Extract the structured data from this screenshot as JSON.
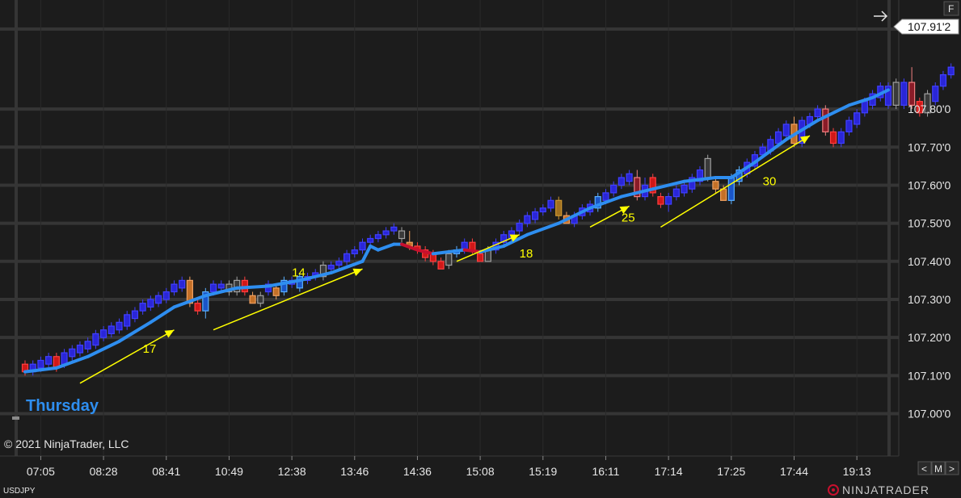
{
  "chart_data": {
    "type": "candlestick",
    "symbol": "USDJPY",
    "day_label": "Thursday",
    "copyright": "© 2021 NinjaTrader, LLC",
    "brand": "NINJATRADER",
    "last_price": "107.91'2",
    "panel_button": "F",
    "nav_buttons": [
      "<",
      "M",
      ">"
    ],
    "ylim": [
      106.91,
      108.01
    ],
    "y_ticks": [
      {
        "value": 107.8,
        "label": "107.80'0"
      },
      {
        "value": 107.7,
        "label": "107.70'0"
      },
      {
        "value": 107.6,
        "label": "107.60'0"
      },
      {
        "value": 107.5,
        "label": "107.50'0"
      },
      {
        "value": 107.4,
        "label": "107.40'0"
      },
      {
        "value": 107.3,
        "label": "107.30'0"
      },
      {
        "value": 107.2,
        "label": "107.20'0"
      },
      {
        "value": 107.1,
        "label": "107.10'0"
      },
      {
        "value": 107.0,
        "label": "107.00'0"
      }
    ],
    "x_ticks": [
      {
        "bar": 2,
        "label": "07:05"
      },
      {
        "bar": 10,
        "label": "08:28"
      },
      {
        "bar": 18,
        "label": "08:41"
      },
      {
        "bar": 26,
        "label": "10:49"
      },
      {
        "bar": 34,
        "label": "12:38"
      },
      {
        "bar": 42,
        "label": "13:46"
      },
      {
        "bar": 50,
        "label": "14:36"
      },
      {
        "bar": 58,
        "label": "15:08"
      },
      {
        "bar": 66,
        "label": "15:19"
      },
      {
        "bar": 74,
        "label": "16:11"
      },
      {
        "bar": 82,
        "label": "17:14"
      },
      {
        "bar": 90,
        "label": "17:25"
      },
      {
        "bar": 98,
        "label": "17:44"
      },
      {
        "bar": 106,
        "label": "19:13"
      }
    ],
    "bar_count": 111,
    "candles": [
      {
        "o": 107.11,
        "c": 107.13,
        "h": 107.14,
        "l": 107.1,
        "k": "r"
      },
      {
        "o": 107.11,
        "c": 107.13,
        "h": 107.14,
        "l": 107.1,
        "k": "b"
      },
      {
        "o": 107.12,
        "c": 107.14,
        "h": 107.15,
        "l": 107.11,
        "k": "b"
      },
      {
        "o": 107.13,
        "c": 107.15,
        "h": 107.16,
        "l": 107.12,
        "k": "b"
      },
      {
        "o": 107.15,
        "c": 107.12,
        "h": 107.16,
        "l": 107.11,
        "k": "r"
      },
      {
        "o": 107.13,
        "c": 107.16,
        "h": 107.17,
        "l": 107.12,
        "k": "b"
      },
      {
        "o": 107.15,
        "c": 107.17,
        "h": 107.18,
        "l": 107.14,
        "k": "b"
      },
      {
        "o": 107.16,
        "c": 107.18,
        "h": 107.19,
        "l": 107.15,
        "k": "b"
      },
      {
        "o": 107.17,
        "c": 107.19,
        "h": 107.2,
        "l": 107.16,
        "k": "b"
      },
      {
        "o": 107.18,
        "c": 107.21,
        "h": 107.22,
        "l": 107.17,
        "k": "b"
      },
      {
        "o": 107.2,
        "c": 107.22,
        "h": 107.23,
        "l": 107.19,
        "k": "b"
      },
      {
        "o": 107.21,
        "c": 107.23,
        "h": 107.24,
        "l": 107.2,
        "k": "b"
      },
      {
        "o": 107.22,
        "c": 107.24,
        "h": 107.25,
        "l": 107.21,
        "k": "b"
      },
      {
        "o": 107.23,
        "c": 107.26,
        "h": 107.27,
        "l": 107.22,
        "k": "b"
      },
      {
        "o": 107.25,
        "c": 107.27,
        "h": 107.28,
        "l": 107.24,
        "k": "b"
      },
      {
        "o": 107.27,
        "c": 107.29,
        "h": 107.3,
        "l": 107.26,
        "k": "b"
      },
      {
        "o": 107.28,
        "c": 107.3,
        "h": 107.31,
        "l": 107.27,
        "k": "b"
      },
      {
        "o": 107.29,
        "c": 107.31,
        "h": 107.32,
        "l": 107.28,
        "k": "b"
      },
      {
        "o": 107.3,
        "c": 107.32,
        "h": 107.33,
        "l": 107.29,
        "k": "b"
      },
      {
        "o": 107.32,
        "c": 107.34,
        "h": 107.35,
        "l": 107.31,
        "k": "b"
      },
      {
        "o": 107.33,
        "c": 107.35,
        "h": 107.36,
        "l": 107.32,
        "k": "b"
      },
      {
        "o": 107.35,
        "c": 107.29,
        "h": 107.36,
        "l": 107.28,
        "k": "o"
      },
      {
        "o": 107.29,
        "c": 107.27,
        "h": 107.3,
        "l": 107.26,
        "k": "r"
      },
      {
        "o": 107.27,
        "c": 107.32,
        "h": 107.33,
        "l": 107.25,
        "k": "l"
      },
      {
        "o": 107.32,
        "c": 107.34,
        "h": 107.35,
        "l": 107.31,
        "k": "b"
      },
      {
        "o": 107.33,
        "c": 107.34,
        "h": 107.35,
        "l": 107.32,
        "k": "b"
      },
      {
        "o": 107.34,
        "c": 107.32,
        "h": 107.35,
        "l": 107.31,
        "k": "g"
      },
      {
        "o": 107.32,
        "c": 107.35,
        "h": 107.36,
        "l": 107.31,
        "k": "g"
      },
      {
        "o": 107.35,
        "c": 107.32,
        "h": 107.36,
        "l": 107.31,
        "k": "r"
      },
      {
        "o": 107.31,
        "c": 107.29,
        "h": 107.32,
        "l": 107.29,
        "k": "o"
      },
      {
        "o": 107.29,
        "c": 107.31,
        "h": 107.32,
        "l": 107.28,
        "k": "g"
      },
      {
        "o": 107.32,
        "c": 107.34,
        "h": 107.35,
        "l": 107.31,
        "k": "b"
      },
      {
        "o": 107.33,
        "c": 107.31,
        "h": 107.34,
        "l": 107.3,
        "k": "o"
      },
      {
        "o": 107.32,
        "c": 107.35,
        "h": 107.36,
        "l": 107.31,
        "k": "l"
      },
      {
        "o": 107.34,
        "c": 107.35,
        "h": 107.36,
        "l": 107.33,
        "k": "b"
      },
      {
        "o": 107.33,
        "c": 107.36,
        "h": 107.37,
        "l": 107.32,
        "k": "l"
      },
      {
        "o": 107.35,
        "c": 107.36,
        "h": 107.37,
        "l": 107.34,
        "k": "b"
      },
      {
        "o": 107.36,
        "c": 107.37,
        "h": 107.38,
        "l": 107.35,
        "k": "b"
      },
      {
        "o": 107.36,
        "c": 107.39,
        "h": 107.4,
        "l": 107.35,
        "k": "g"
      },
      {
        "o": 107.38,
        "c": 107.39,
        "h": 107.4,
        "l": 107.37,
        "k": "b"
      },
      {
        "o": 107.39,
        "c": 107.4,
        "h": 107.41,
        "l": 107.38,
        "k": "b"
      },
      {
        "o": 107.4,
        "c": 107.42,
        "h": 107.43,
        "l": 107.39,
        "k": "b"
      },
      {
        "o": 107.42,
        "c": 107.43,
        "h": 107.44,
        "l": 107.41,
        "k": "b"
      },
      {
        "o": 107.43,
        "c": 107.45,
        "h": 107.46,
        "l": 107.42,
        "k": "b"
      },
      {
        "o": 107.45,
        "c": 107.46,
        "h": 107.47,
        "l": 107.44,
        "k": "b"
      },
      {
        "o": 107.46,
        "c": 107.47,
        "h": 107.48,
        "l": 107.45,
        "k": "b"
      },
      {
        "o": 107.47,
        "c": 107.48,
        "h": 107.49,
        "l": 107.46,
        "k": "b"
      },
      {
        "o": 107.48,
        "c": 107.49,
        "h": 107.5,
        "l": 107.47,
        "k": "b"
      },
      {
        "o": 107.48,
        "c": 107.46,
        "h": 107.49,
        "l": 107.45,
        "k": "g"
      },
      {
        "o": 107.45,
        "c": 107.44,
        "h": 107.48,
        "l": 107.43,
        "k": "o"
      },
      {
        "o": 107.44,
        "c": 107.43,
        "h": 107.45,
        "l": 107.42,
        "k": "r"
      },
      {
        "o": 107.43,
        "c": 107.41,
        "h": 107.44,
        "l": 107.4,
        "k": "r"
      },
      {
        "o": 107.42,
        "c": 107.4,
        "h": 107.43,
        "l": 107.39,
        "k": "r"
      },
      {
        "o": 107.4,
        "c": 107.38,
        "h": 107.41,
        "l": 107.38,
        "k": "r"
      },
      {
        "o": 107.39,
        "c": 107.42,
        "h": 107.43,
        "l": 107.38,
        "k": "g"
      },
      {
        "o": 107.42,
        "c": 107.43,
        "h": 107.44,
        "l": 107.41,
        "k": "l"
      },
      {
        "o": 107.43,
        "c": 107.45,
        "h": 107.46,
        "l": 107.42,
        "k": "b"
      },
      {
        "o": 107.45,
        "c": 107.43,
        "h": 107.46,
        "l": 107.42,
        "k": "r"
      },
      {
        "o": 107.42,
        "c": 107.4,
        "h": 107.43,
        "l": 107.4,
        "k": "r"
      },
      {
        "o": 107.4,
        "c": 107.43,
        "h": 107.44,
        "l": 107.4,
        "k": "g"
      },
      {
        "o": 107.43,
        "c": 107.45,
        "h": 107.46,
        "l": 107.42,
        "k": "b"
      },
      {
        "o": 107.45,
        "c": 107.47,
        "h": 107.48,
        "l": 107.44,
        "k": "b"
      },
      {
        "o": 107.46,
        "c": 107.48,
        "h": 107.49,
        "l": 107.45,
        "k": "b"
      },
      {
        "o": 107.48,
        "c": 107.5,
        "h": 107.51,
        "l": 107.47,
        "k": "b"
      },
      {
        "o": 107.5,
        "c": 107.52,
        "h": 107.53,
        "l": 107.49,
        "k": "b"
      },
      {
        "o": 107.51,
        "c": 107.53,
        "h": 107.54,
        "l": 107.5,
        "k": "b"
      },
      {
        "o": 107.53,
        "c": 107.54,
        "h": 107.55,
        "l": 107.52,
        "k": "b"
      },
      {
        "o": 107.54,
        "c": 107.56,
        "h": 107.57,
        "l": 107.53,
        "k": "b"
      },
      {
        "o": 107.56,
        "c": 107.52,
        "h": 107.57,
        "l": 107.51,
        "k": "d"
      },
      {
        "o": 107.52,
        "c": 107.5,
        "h": 107.53,
        "l": 107.5,
        "k": "o"
      },
      {
        "o": 107.5,
        "c": 107.52,
        "h": 107.53,
        "l": 107.49,
        "k": "b"
      },
      {
        "o": 107.52,
        "c": 107.54,
        "h": 107.55,
        "l": 107.51,
        "k": "b"
      },
      {
        "o": 107.53,
        "c": 107.55,
        "h": 107.56,
        "l": 107.52,
        "k": "b"
      },
      {
        "o": 107.54,
        "c": 107.57,
        "h": 107.58,
        "l": 107.53,
        "k": "l"
      },
      {
        "o": 107.56,
        "c": 107.58,
        "h": 107.59,
        "l": 107.55,
        "k": "b"
      },
      {
        "o": 107.58,
        "c": 107.6,
        "h": 107.61,
        "l": 107.57,
        "k": "b"
      },
      {
        "o": 107.6,
        "c": 107.62,
        "h": 107.63,
        "l": 107.59,
        "k": "b"
      },
      {
        "o": 107.61,
        "c": 107.63,
        "h": 107.64,
        "l": 107.6,
        "k": "b"
      },
      {
        "o": 107.62,
        "c": 107.57,
        "h": 107.64,
        "l": 107.56,
        "k": "m"
      },
      {
        "o": 107.57,
        "c": 107.6,
        "h": 107.62,
        "l": 107.56,
        "k": "b"
      },
      {
        "o": 107.62,
        "c": 107.58,
        "h": 107.63,
        "l": 107.57,
        "k": "r"
      },
      {
        "o": 107.57,
        "c": 107.55,
        "h": 107.58,
        "l": 107.54,
        "k": "r"
      },
      {
        "o": 107.55,
        "c": 107.57,
        "h": 107.58,
        "l": 107.53,
        "k": "b"
      },
      {
        "o": 107.57,
        "c": 107.59,
        "h": 107.6,
        "l": 107.56,
        "k": "b"
      },
      {
        "o": 107.58,
        "c": 107.6,
        "h": 107.61,
        "l": 107.57,
        "k": "b"
      },
      {
        "o": 107.59,
        "c": 107.62,
        "h": 107.63,
        "l": 107.58,
        "k": "b"
      },
      {
        "o": 107.61,
        "c": 107.64,
        "h": 107.65,
        "l": 107.6,
        "k": "b"
      },
      {
        "o": 107.62,
        "c": 107.67,
        "h": 107.68,
        "l": 107.61,
        "k": "g"
      },
      {
        "o": 107.61,
        "c": 107.59,
        "h": 107.62,
        "l": 107.58,
        "k": "o"
      },
      {
        "o": 107.59,
        "c": 107.56,
        "h": 107.6,
        "l": 107.56,
        "k": "o"
      },
      {
        "o": 107.56,
        "c": 107.62,
        "h": 107.63,
        "l": 107.55,
        "k": "l"
      },
      {
        "o": 107.61,
        "c": 107.64,
        "h": 107.65,
        "l": 107.6,
        "k": "l"
      },
      {
        "o": 107.63,
        "c": 107.66,
        "h": 107.67,
        "l": 107.62,
        "k": "b"
      },
      {
        "o": 107.65,
        "c": 107.68,
        "h": 107.69,
        "l": 107.64,
        "k": "b"
      },
      {
        "o": 107.68,
        "c": 107.7,
        "h": 107.71,
        "l": 107.67,
        "k": "b"
      },
      {
        "o": 107.69,
        "c": 107.72,
        "h": 107.73,
        "l": 107.68,
        "k": "b"
      },
      {
        "o": 107.71,
        "c": 107.74,
        "h": 107.75,
        "l": 107.7,
        "k": "b"
      },
      {
        "o": 107.73,
        "c": 107.76,
        "h": 107.77,
        "l": 107.72,
        "k": "b"
      },
      {
        "o": 107.76,
        "c": 107.71,
        "h": 107.78,
        "l": 107.7,
        "k": "o"
      },
      {
        "o": 107.71,
        "c": 107.77,
        "h": 107.78,
        "l": 107.7,
        "k": "b"
      },
      {
        "o": 107.76,
        "c": 107.78,
        "h": 107.79,
        "l": 107.75,
        "k": "b"
      },
      {
        "o": 107.78,
        "c": 107.8,
        "h": 107.81,
        "l": 107.77,
        "k": "b"
      },
      {
        "o": 107.8,
        "c": 107.74,
        "h": 107.81,
        "l": 107.73,
        "k": "m"
      },
      {
        "o": 107.74,
        "c": 107.71,
        "h": 107.75,
        "l": 107.7,
        "k": "r"
      },
      {
        "o": 107.71,
        "c": 107.74,
        "h": 107.75,
        "l": 107.7,
        "k": "b"
      },
      {
        "o": 107.74,
        "c": 107.77,
        "h": 107.78,
        "l": 107.73,
        "k": "b"
      },
      {
        "o": 107.76,
        "c": 107.79,
        "h": 107.8,
        "l": 107.75,
        "k": "b"
      },
      {
        "o": 107.79,
        "c": 107.82,
        "h": 107.83,
        "l": 107.78,
        "k": "b"
      },
      {
        "o": 107.81,
        "c": 107.84,
        "h": 107.85,
        "l": 107.8,
        "k": "b"
      },
      {
        "o": 107.83,
        "c": 107.86,
        "h": 107.87,
        "l": 107.82,
        "k": "b"
      },
      {
        "o": 107.86,
        "c": 107.81,
        "h": 107.87,
        "l": 107.8,
        "k": "b"
      },
      {
        "o": 107.81,
        "c": 107.87,
        "h": 107.88,
        "l": 107.8,
        "k": "g"
      },
      {
        "o": 107.87,
        "c": 107.81,
        "h": 107.88,
        "l": 107.8,
        "k": "b"
      },
      {
        "o": 107.81,
        "c": 107.87,
        "h": 107.91,
        "l": 107.8,
        "k": "m"
      },
      {
        "o": 107.82,
        "c": 107.79,
        "h": 107.83,
        "l": 107.78,
        "k": "r"
      },
      {
        "o": 107.79,
        "c": 107.84,
        "h": 107.85,
        "l": 107.78,
        "k": "g"
      },
      {
        "o": 107.82,
        "c": 107.86,
        "h": 107.87,
        "l": 107.81,
        "k": "b"
      },
      {
        "o": 107.86,
        "c": 107.89,
        "h": 107.9,
        "l": 107.85,
        "k": "b"
      },
      {
        "o": 107.89,
        "c": 107.91,
        "h": 107.92,
        "l": 107.88,
        "k": "b"
      }
    ],
    "ma": [
      {
        "bar": 0,
        "v": 107.11,
        "c": "#2e8ef0"
      },
      {
        "bar": 4,
        "v": 107.12,
        "c": "#2e8ef0"
      },
      {
        "bar": 8,
        "v": 107.15,
        "c": "#2e8ef0"
      },
      {
        "bar": 12,
        "v": 107.19,
        "c": "#2e8ef0"
      },
      {
        "bar": 16,
        "v": 107.24,
        "c": "#2e8ef0"
      },
      {
        "bar": 19,
        "v": 107.28,
        "c": "#2e8ef0"
      },
      {
        "bar": 23,
        "v": 107.31,
        "c": "#2e8ef0"
      },
      {
        "bar": 27,
        "v": 107.33,
        "c": "#2e8ef0"
      },
      {
        "bar": 31,
        "v": 107.335,
        "c": "#2e8ef0"
      },
      {
        "bar": 35,
        "v": 107.35,
        "c": "#2e8ef0"
      },
      {
        "bar": 39,
        "v": 107.37,
        "c": "#2e8ef0"
      },
      {
        "bar": 43,
        "v": 107.4,
        "c": "#2e8ef0"
      },
      {
        "bar": 44,
        "v": 107.44,
        "c": "#2e8ef0"
      },
      {
        "bar": 45,
        "v": 107.43,
        "c": "#2e8ef0"
      },
      {
        "bar": 47,
        "v": 107.445,
        "c": "#2e8ef0"
      },
      {
        "bar": 48,
        "v": 107.445,
        "c": "#c8102e"
      },
      {
        "bar": 50,
        "v": 107.43,
        "c": "#c8102e"
      },
      {
        "bar": 52,
        "v": 107.42,
        "c": "#2e8ef0"
      },
      {
        "bar": 54,
        "v": 107.425,
        "c": "#2e8ef0"
      },
      {
        "bar": 56,
        "v": 107.43,
        "c": "#c8102e"
      },
      {
        "bar": 58,
        "v": 107.425,
        "c": "#2e8ef0"
      },
      {
        "bar": 61,
        "v": 107.44,
        "c": "#2e8ef0"
      },
      {
        "bar": 64,
        "v": 107.47,
        "c": "#2e8ef0"
      },
      {
        "bar": 68,
        "v": 107.5,
        "c": "#2e8ef0"
      },
      {
        "bar": 72,
        "v": 107.54,
        "c": "#2e8ef0"
      },
      {
        "bar": 76,
        "v": 107.57,
        "c": "#2e8ef0"
      },
      {
        "bar": 80,
        "v": 107.59,
        "c": "#2e8ef0"
      },
      {
        "bar": 84,
        "v": 107.61,
        "c": "#2e8ef0"
      },
      {
        "bar": 88,
        "v": 107.62,
        "c": "#2e8ef0"
      },
      {
        "bar": 90,
        "v": 107.62,
        "c": "#2e8ef0"
      },
      {
        "bar": 93,
        "v": 107.66,
        "c": "#2e8ef0"
      },
      {
        "bar": 97,
        "v": 107.72,
        "c": "#2e8ef0"
      },
      {
        "bar": 101,
        "v": 107.77,
        "c": "#2e8ef0"
      },
      {
        "bar": 105,
        "v": 107.81,
        "c": "#2e8ef0"
      },
      {
        "bar": 108,
        "v": 107.83,
        "c": "#2e8ef0"
      },
      {
        "bar": 110,
        "v": 107.85,
        "c": "#2e8ef0"
      }
    ],
    "annotations": [
      {
        "text": "17",
        "x": 15,
        "y": 107.16,
        "arrow": [
          [
            7,
            107.08
          ],
          [
            19,
            107.22
          ]
        ]
      },
      {
        "text": "14",
        "x": 34,
        "y": 107.36,
        "arrow": [
          [
            24,
            107.22
          ],
          [
            43,
            107.38
          ]
        ]
      },
      {
        "text": "18",
        "x": 63,
        "y": 107.41,
        "arrow": [
          [
            55,
            107.4
          ],
          [
            63,
            107.47
          ]
        ]
      },
      {
        "text": "25",
        "x": 76,
        "y": 107.505,
        "arrow": [
          [
            72,
            107.49
          ],
          [
            77,
            107.545
          ]
        ]
      },
      {
        "text": "30",
        "x": 94,
        "y": 107.6,
        "arrow": [
          [
            81,
            107.49
          ],
          [
            100,
            107.73
          ]
        ]
      }
    ]
  }
}
